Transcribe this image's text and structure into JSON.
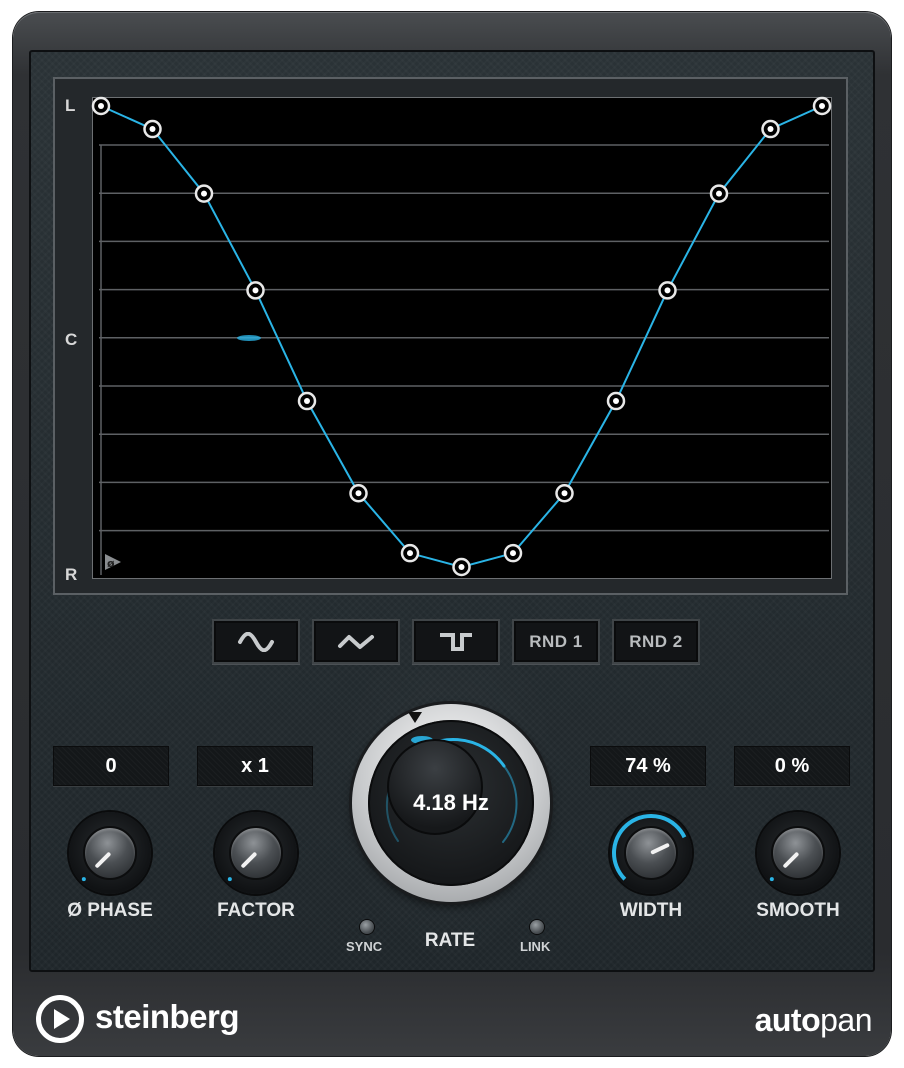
{
  "brand": "steinberg",
  "product": {
    "bold": "auto",
    "light": "pan"
  },
  "graph": {
    "y_labels": {
      "top": "L",
      "middle": "C",
      "bottom": "R"
    },
    "phase_marker": "ø",
    "points": [
      1.0,
      0.95,
      0.81,
      0.6,
      0.36,
      0.16,
      0.03,
      0.0,
      0.03,
      0.16,
      0.36,
      0.6,
      0.81,
      0.95,
      1.0
    ],
    "line_color": "#2ab4e6"
  },
  "shapes": [
    {
      "label": "",
      "icon": "sine-wave-icon"
    },
    {
      "label": "",
      "icon": "triangle-wave-icon"
    },
    {
      "label": "",
      "icon": "square-wave-icon"
    },
    {
      "label": "RND 1",
      "icon": ""
    },
    {
      "label": "RND 2",
      "icon": ""
    }
  ],
  "controls": {
    "phase": {
      "value": "0",
      "label": "Ø PHASE",
      "level": 0.0
    },
    "factor": {
      "value": "x 1",
      "label": "FACTOR",
      "level": 0.0
    },
    "rate": {
      "value": "4.18 Hz",
      "label": "RATE",
      "sync_label": "SYNC",
      "link_label": "LINK"
    },
    "width": {
      "value": "74 %",
      "label": "WIDTH",
      "level": 0.74
    },
    "smooth": {
      "value": "0 %",
      "label": "SMOOTH",
      "level": 0.0
    }
  },
  "accent_color": "#2ab4e6"
}
